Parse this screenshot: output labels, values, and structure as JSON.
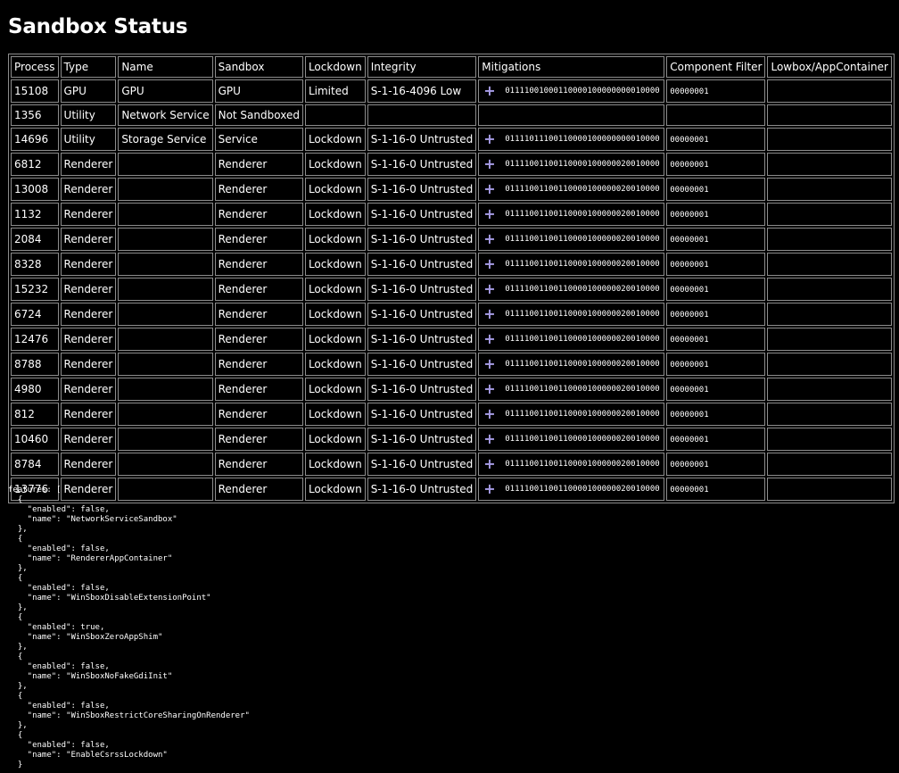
{
  "page": {
    "title": "Sandbox Status"
  },
  "table": {
    "headers": [
      "Process",
      "Type",
      "Name",
      "Sandbox",
      "Lockdown",
      "Integrity",
      "Mitigations",
      "Component Filter",
      "Lowbox/AppContainer"
    ],
    "rows": [
      {
        "process": "15108",
        "type": "GPU",
        "name": "GPU",
        "sandbox": "GPU",
        "lockdown": "Limited",
        "integrity": "S-1-16-4096 Low",
        "mitigations": "01111001000110000100000000010000",
        "component_filter": "00000001",
        "lowbox": "",
        "has_expand": true
      },
      {
        "process": "1356",
        "type": "Utility",
        "name": "Network Service",
        "sandbox": "Not Sandboxed",
        "lockdown": "",
        "integrity": "",
        "mitigations": "",
        "component_filter": "",
        "lowbox": "",
        "has_expand": false
      },
      {
        "process": "14696",
        "type": "Utility",
        "name": "Storage Service",
        "sandbox": "Service",
        "lockdown": "Lockdown",
        "integrity": "S-1-16-0 Untrusted",
        "mitigations": "01111011100110000100000000010000",
        "component_filter": "00000001",
        "lowbox": "",
        "has_expand": true
      },
      {
        "process": "6812",
        "type": "Renderer",
        "name": "",
        "sandbox": "Renderer",
        "lockdown": "Lockdown",
        "integrity": "S-1-16-0 Untrusted",
        "mitigations": "01111001100110000100000020010000",
        "component_filter": "00000001",
        "lowbox": "",
        "has_expand": true
      },
      {
        "process": "13008",
        "type": "Renderer",
        "name": "",
        "sandbox": "Renderer",
        "lockdown": "Lockdown",
        "integrity": "S-1-16-0 Untrusted",
        "mitigations": "01111001100110000100000020010000",
        "component_filter": "00000001",
        "lowbox": "",
        "has_expand": true
      },
      {
        "process": "1132",
        "type": "Renderer",
        "name": "",
        "sandbox": "Renderer",
        "lockdown": "Lockdown",
        "integrity": "S-1-16-0 Untrusted",
        "mitigations": "01111001100110000100000020010000",
        "component_filter": "00000001",
        "lowbox": "",
        "has_expand": true
      },
      {
        "process": "2084",
        "type": "Renderer",
        "name": "",
        "sandbox": "Renderer",
        "lockdown": "Lockdown",
        "integrity": "S-1-16-0 Untrusted",
        "mitigations": "01111001100110000100000020010000",
        "component_filter": "00000001",
        "lowbox": "",
        "has_expand": true
      },
      {
        "process": "8328",
        "type": "Renderer",
        "name": "",
        "sandbox": "Renderer",
        "lockdown": "Lockdown",
        "integrity": "S-1-16-0 Untrusted",
        "mitigations": "01111001100110000100000020010000",
        "component_filter": "00000001",
        "lowbox": "",
        "has_expand": true
      },
      {
        "process": "15232",
        "type": "Renderer",
        "name": "",
        "sandbox": "Renderer",
        "lockdown": "Lockdown",
        "integrity": "S-1-16-0 Untrusted",
        "mitigations": "01111001100110000100000020010000",
        "component_filter": "00000001",
        "lowbox": "",
        "has_expand": true
      },
      {
        "process": "6724",
        "type": "Renderer",
        "name": "",
        "sandbox": "Renderer",
        "lockdown": "Lockdown",
        "integrity": "S-1-16-0 Untrusted",
        "mitigations": "01111001100110000100000020010000",
        "component_filter": "00000001",
        "lowbox": "",
        "has_expand": true
      },
      {
        "process": "12476",
        "type": "Renderer",
        "name": "",
        "sandbox": "Renderer",
        "lockdown": "Lockdown",
        "integrity": "S-1-16-0 Untrusted",
        "mitigations": "01111001100110000100000020010000",
        "component_filter": "00000001",
        "lowbox": "",
        "has_expand": true
      },
      {
        "process": "8788",
        "type": "Renderer",
        "name": "",
        "sandbox": "Renderer",
        "lockdown": "Lockdown",
        "integrity": "S-1-16-0 Untrusted",
        "mitigations": "01111001100110000100000020010000",
        "component_filter": "00000001",
        "lowbox": "",
        "has_expand": true
      },
      {
        "process": "4980",
        "type": "Renderer",
        "name": "",
        "sandbox": "Renderer",
        "lockdown": "Lockdown",
        "integrity": "S-1-16-0 Untrusted",
        "mitigations": "01111001100110000100000020010000",
        "component_filter": "00000001",
        "lowbox": "",
        "has_expand": true
      },
      {
        "process": "812",
        "type": "Renderer",
        "name": "",
        "sandbox": "Renderer",
        "lockdown": "Lockdown",
        "integrity": "S-1-16-0 Untrusted",
        "mitigations": "01111001100110000100000020010000",
        "component_filter": "00000001",
        "lowbox": "",
        "has_expand": true
      },
      {
        "process": "10460",
        "type": "Renderer",
        "name": "",
        "sandbox": "Renderer",
        "lockdown": "Lockdown",
        "integrity": "S-1-16-0 Untrusted",
        "mitigations": "01111001100110000100000020010000",
        "component_filter": "00000001",
        "lowbox": "",
        "has_expand": true
      },
      {
        "process": "8784",
        "type": "Renderer",
        "name": "",
        "sandbox": "Renderer",
        "lockdown": "Lockdown",
        "integrity": "S-1-16-0 Untrusted",
        "mitigations": "01111001100110000100000020010000",
        "component_filter": "00000001",
        "lowbox": "",
        "has_expand": true
      },
      {
        "process": "13776",
        "type": "Renderer",
        "name": "",
        "sandbox": "Renderer",
        "lockdown": "Lockdown",
        "integrity": "S-1-16-0 Untrusted",
        "mitigations": "01111001100110000100000020010000",
        "component_filter": "00000001",
        "lowbox": "",
        "has_expand": true
      }
    ]
  },
  "features": {
    "label": "features: [",
    "items": [
      {
        "enabled": "false",
        "name": "NetworkServiceSandbox"
      },
      {
        "enabled": "false",
        "name": "RendererAppContainer"
      },
      {
        "enabled": "false",
        "name": "WinSboxDisableExtensionPoint"
      },
      {
        "enabled": "true",
        "name": "WinSboxZeroAppShim"
      },
      {
        "enabled": "false",
        "name": "WinSboxNoFakeGdiInit"
      },
      {
        "enabled": "false",
        "name": "WinSboxRestrictCoreSharingOnRenderer"
      },
      {
        "enabled": "false",
        "name": "EnableCsrssLockdown"
      }
    ]
  },
  "icons": {
    "expand": "plus-icon"
  },
  "colors": {
    "background": "#000000",
    "text": "#ffffff",
    "border": "#8c8c8c",
    "accent": "#a89de8"
  }
}
